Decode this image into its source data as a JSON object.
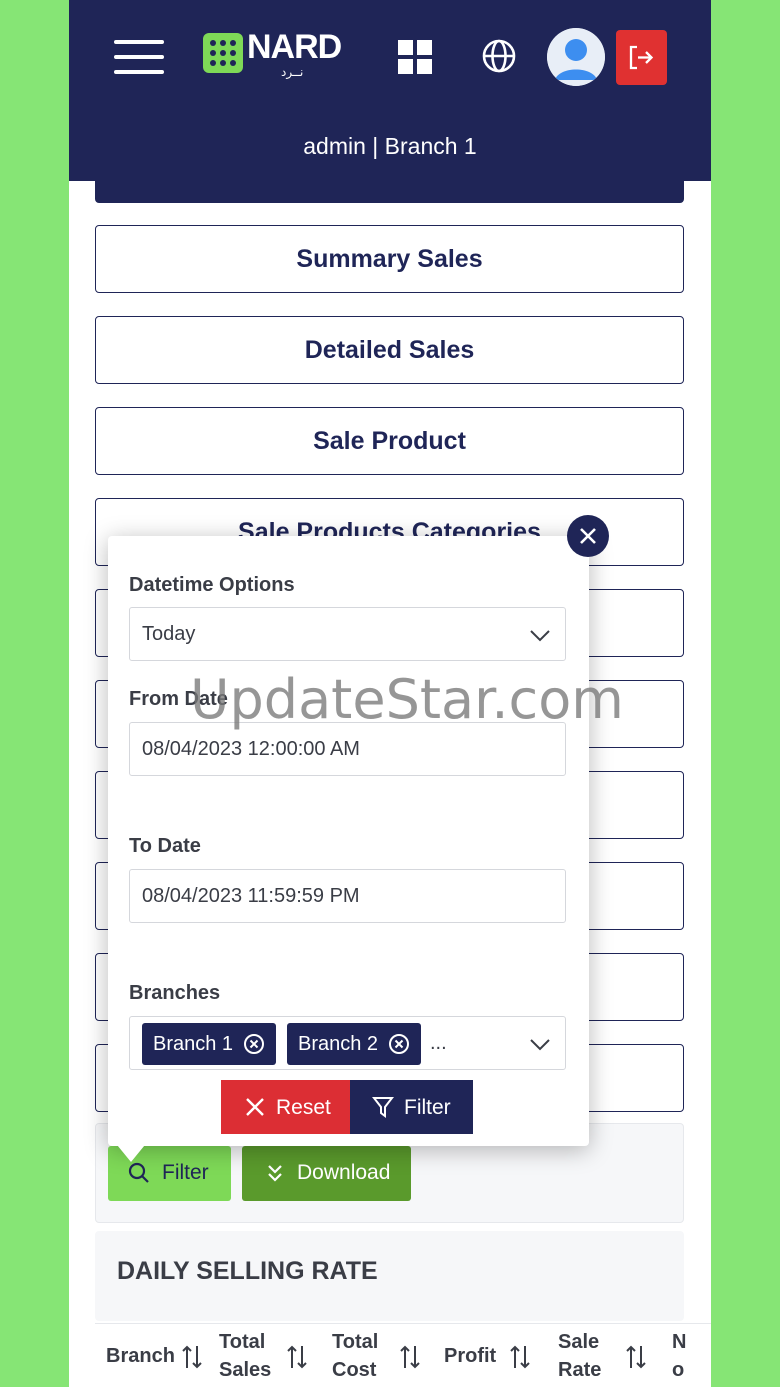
{
  "header": {
    "brand": "NARD",
    "brand_sub": "نــرد",
    "user_line": "admin | Branch 1"
  },
  "reports": [
    {
      "label": "Summary Sales"
    },
    {
      "label": "Detailed Sales"
    },
    {
      "label": "Sale Product"
    },
    {
      "label": "Sale Products Categories"
    }
  ],
  "actions": {
    "filter_label": "Filter",
    "download_label": "Download"
  },
  "daily": {
    "title": "DAILY SELLING RATE",
    "columns": [
      {
        "line1": "Branch",
        "line2": ""
      },
      {
        "line1": "Total",
        "line2": "Sales"
      },
      {
        "line1": "Total",
        "line2": "Cost"
      },
      {
        "line1": "Profit",
        "line2": ""
      },
      {
        "line1": "Sale",
        "line2": "Rate"
      },
      {
        "line1": "N",
        "line2": "o"
      }
    ]
  },
  "popup": {
    "datetime_label": "Datetime Options",
    "datetime_value": "Today",
    "from_label": "From Date",
    "from_value": "08/04/2023 12:00:00 AM",
    "to_label": "To Date",
    "to_value": "08/04/2023 11:59:59 PM",
    "branches_label": "Branches",
    "branches": [
      "Branch 1",
      "Branch 2"
    ],
    "more": "...",
    "reset_label": "Reset",
    "filter_label": "Filter"
  },
  "watermark": "UpdateStar.com",
  "colors": {
    "navy": "#1f2557",
    "green": "#7ed957",
    "dark_green": "#5a9a2c",
    "red": "#dc2e34",
    "background": "#86e575"
  }
}
